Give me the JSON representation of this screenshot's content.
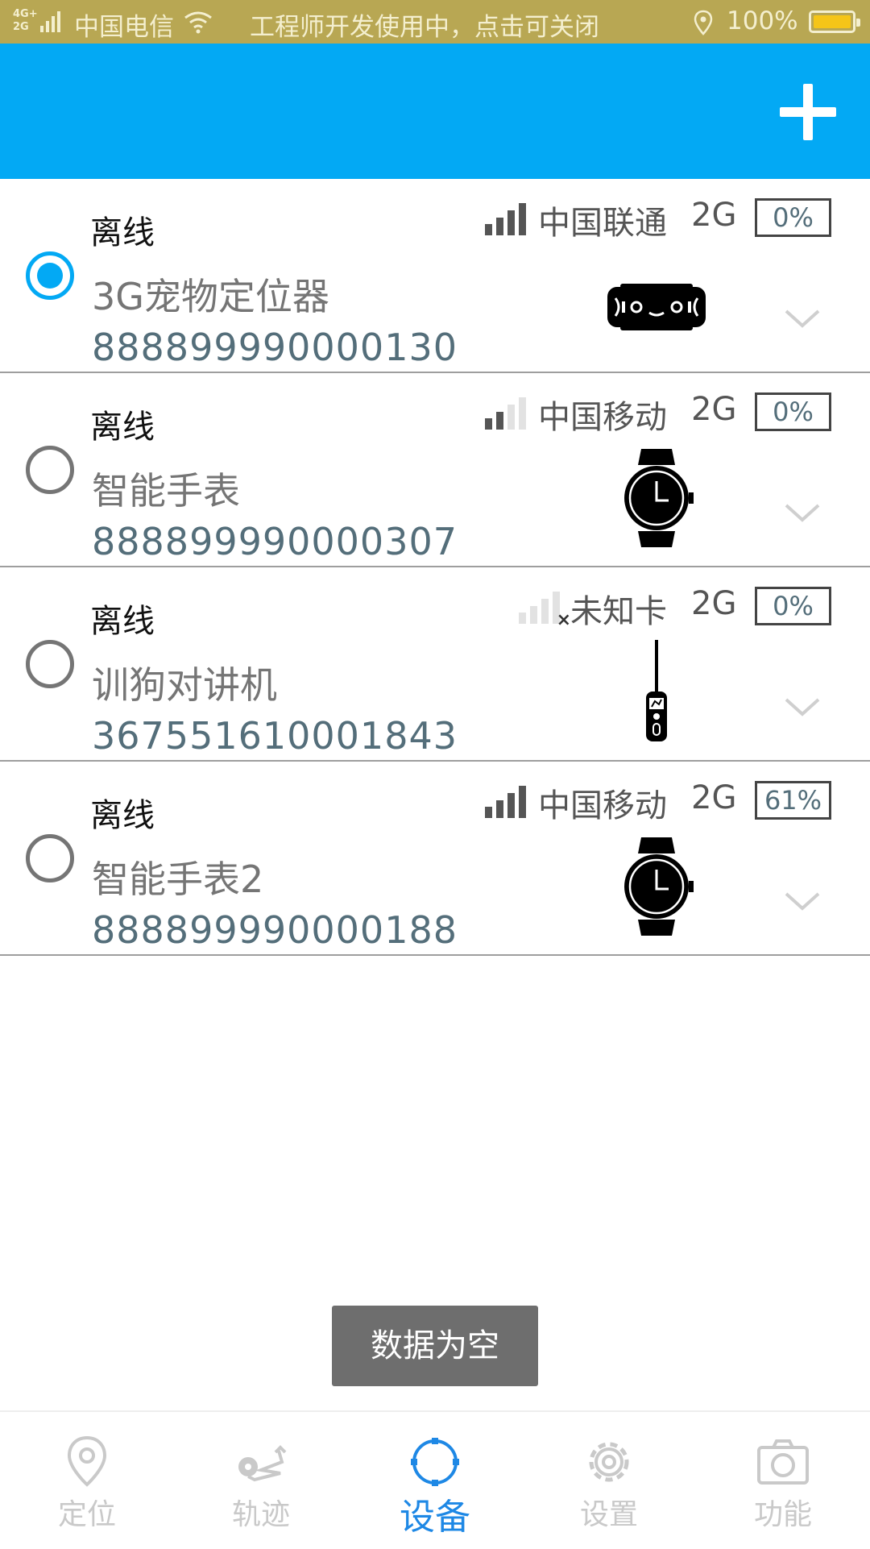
{
  "status_bar": {
    "network": "4G+ 2G",
    "carrier": "中国电信",
    "notice": "工程师开发使用中，点击可关闭",
    "battery_pct": "100%",
    "wifi_icon": "wifi-icon",
    "location_icon": "location-pin-icon"
  },
  "header": {
    "add_icon": "plus-icon",
    "background": "#03a9f4"
  },
  "devices": [
    {
      "status": "离线",
      "name": "3G宠物定位器",
      "id": "888899990000130",
      "carrier": "中国联通",
      "net": "2G",
      "battery": "0%",
      "signal_bars": 4,
      "selected": true,
      "icon": "pet-collar-icon"
    },
    {
      "status": "离线",
      "name": "智能手表",
      "id": "888899990000307",
      "carrier": "中国移动",
      "net": "2G",
      "battery": "0%",
      "signal_bars": 2,
      "selected": false,
      "icon": "smartwatch-icon"
    },
    {
      "status": "离线",
      "name": "训狗对讲机",
      "id": "367551610001843",
      "carrier": "未知卡",
      "net": "2G",
      "battery": "0%",
      "signal_bars": 0,
      "selected": false,
      "icon": "walkie-talkie-icon"
    },
    {
      "status": "离线",
      "name": "智能手表2",
      "id": "888899990000188",
      "carrier": "中国移动",
      "net": "2G",
      "battery": "61%",
      "signal_bars": 4,
      "selected": false,
      "icon": "smartwatch-icon"
    }
  ],
  "toast": "数据为空",
  "nav": [
    {
      "label": "定位",
      "icon": "location-pin-icon",
      "active": false
    },
    {
      "label": "轨迹",
      "icon": "track-icon",
      "active": false
    },
    {
      "label": "设备",
      "icon": "device-circle-icon",
      "active": true
    },
    {
      "label": "设置",
      "icon": "gear-icon",
      "active": false
    },
    {
      "label": "功能",
      "icon": "camera-icon",
      "active": false
    }
  ],
  "colors": {
    "accent": "#03a9f4",
    "nav_active": "#1e88e5",
    "status_bar": "#b8a753"
  }
}
